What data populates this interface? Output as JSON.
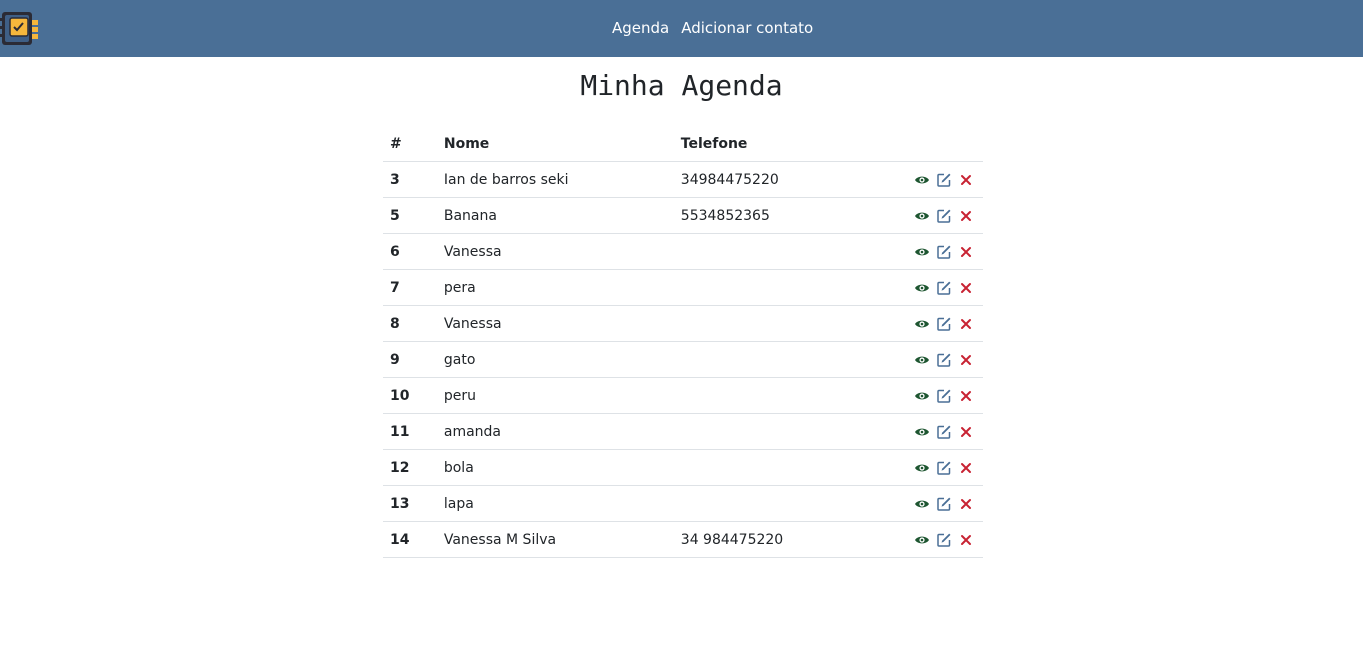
{
  "header": {
    "logo_icon": "contact-book-icon",
    "nav": [
      {
        "label": "Agenda"
      },
      {
        "label": "Adicionar contato"
      }
    ],
    "background": "#4a6f96"
  },
  "page": {
    "title": "Minha Agenda"
  },
  "table": {
    "columns": [
      "#",
      "Nome",
      "Telefone"
    ],
    "rows": [
      {
        "id": "3",
        "name": "Ian de barros seki",
        "phone": "34984475220"
      },
      {
        "id": "5",
        "name": "Banana",
        "phone": "5534852365"
      },
      {
        "id": "6",
        "name": "Vanessa",
        "phone": ""
      },
      {
        "id": "7",
        "name": "pera",
        "phone": ""
      },
      {
        "id": "8",
        "name": "Vanessa",
        "phone": ""
      },
      {
        "id": "9",
        "name": "gato",
        "phone": ""
      },
      {
        "id": "10",
        "name": "peru",
        "phone": ""
      },
      {
        "id": "11",
        "name": "amanda",
        "phone": ""
      },
      {
        "id": "12",
        "name": "bola",
        "phone": ""
      },
      {
        "id": "13",
        "name": "lapa",
        "phone": ""
      },
      {
        "id": "14",
        "name": "Vanessa M Silva",
        "phone": "34 984475220"
      }
    ],
    "action_icons": [
      "eye-icon",
      "edit-icon",
      "delete-icon"
    ],
    "colors": {
      "view": "#1e5631",
      "edit": "#4a6f96",
      "delete": "#c82333"
    }
  }
}
